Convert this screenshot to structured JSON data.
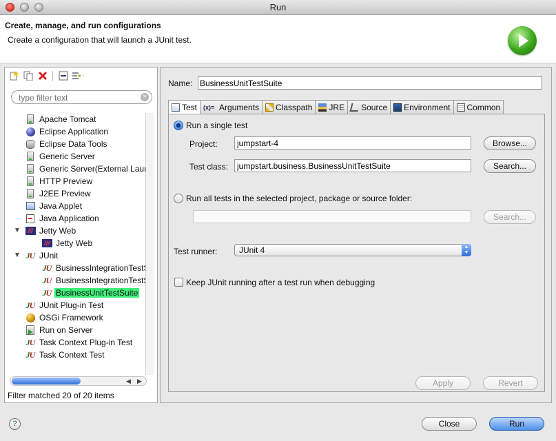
{
  "window": {
    "title": "Run"
  },
  "header": {
    "title": "Create, manage, and run configurations",
    "subtitle": "Create a configuration that will launch a JUnit test."
  },
  "left": {
    "filter_placeholder": "type filter text",
    "status": "Filter matched 20 of 20 items",
    "tree": [
      {
        "label": "Apache Tomcat",
        "icon": "server-icon"
      },
      {
        "label": "Eclipse Application",
        "icon": "eclipse-icon"
      },
      {
        "label": "Eclipse Data Tools",
        "icon": "database-icon"
      },
      {
        "label": "Generic Server",
        "icon": "server-icon"
      },
      {
        "label": "Generic Server(External Launc",
        "icon": "server-icon"
      },
      {
        "label": "HTTP Preview",
        "icon": "server-icon"
      },
      {
        "label": "J2EE Preview",
        "icon": "server-icon"
      },
      {
        "label": "Java Applet",
        "icon": "applet-icon"
      },
      {
        "label": "Java Application",
        "icon": "java-application-icon"
      },
      {
        "label": "Jetty Web",
        "icon": "jetty-icon",
        "expanded": true
      },
      {
        "label": "Jetty Web",
        "icon": "jetty-icon",
        "child": true
      },
      {
        "label": "JUnit",
        "icon": "junit-icon",
        "expanded": true
      },
      {
        "label": "BusinessIntegrationTestS",
        "icon": "junit-icon",
        "child": true
      },
      {
        "label": "BusinessIntegrationTestS",
        "icon": "junit-icon",
        "child": true
      },
      {
        "label": "BusinessUnitTestSuite",
        "icon": "junit-icon",
        "child": true,
        "selected": true
      },
      {
        "label": "JUnit Plug-in Test",
        "icon": "junit-plugin-icon"
      },
      {
        "label": "OSGi Framework",
        "icon": "osgi-icon"
      },
      {
        "label": "Run on Server",
        "icon": "run-on-server-icon"
      },
      {
        "label": "Task Context Plug-in Test",
        "icon": "junit-plugin-icon"
      },
      {
        "label": "Task Context Test",
        "icon": "junit-icon"
      }
    ]
  },
  "right": {
    "name_label": "Name:",
    "name_value": "BusinessUnitTestSuite",
    "tabs": [
      {
        "label": "Test",
        "active": true
      },
      {
        "label": "Arguments"
      },
      {
        "label": "Classpath"
      },
      {
        "label": "JRE"
      },
      {
        "label": "Source"
      },
      {
        "label": "Environment"
      },
      {
        "label": "Common"
      }
    ],
    "run_single_label": "Run a single test",
    "project_label": "Project:",
    "project_value": "jumpstart-4",
    "browse_label": "Browse...",
    "test_class_label": "Test class:",
    "test_class_value": "jumpstart.business.BusinessUnitTestSuite",
    "search_label": "Search...",
    "run_all_label": "Run all tests in the selected project, package or source folder:",
    "run_all_value": "",
    "search2_label": "Search...",
    "test_runner_label": "Test runner:",
    "test_runner_value": "JUnit 4",
    "keep_running_label": "Keep JUnit running after a test run when debugging",
    "apply_label": "Apply",
    "revert_label": "Revert"
  },
  "footer": {
    "help_icon": "?",
    "close_label": "Close",
    "run_label": "Run"
  }
}
